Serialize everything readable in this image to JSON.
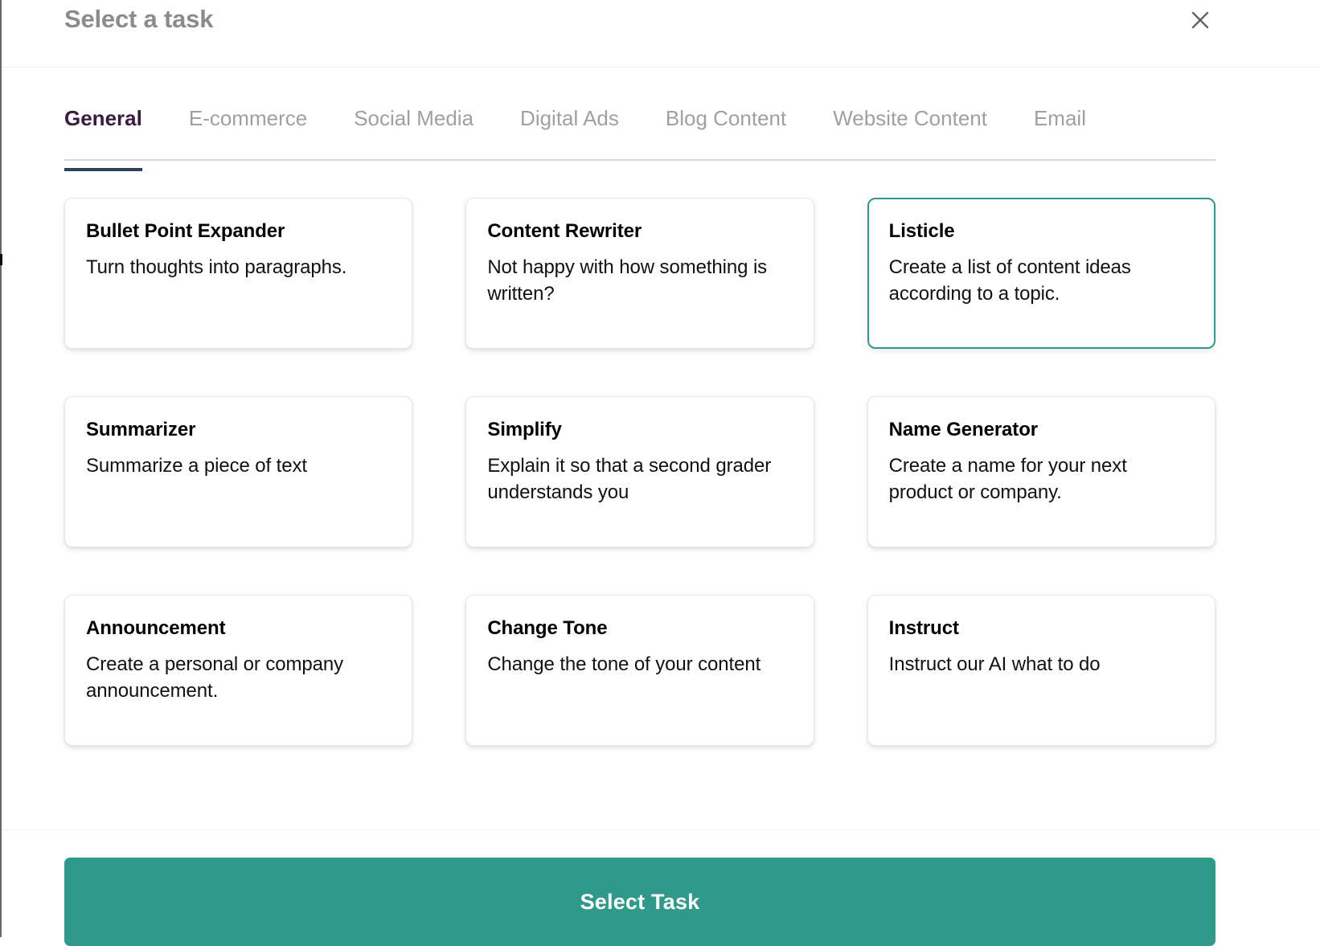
{
  "header": {
    "title": "Select a task",
    "close_icon": "close-icon"
  },
  "tabs": [
    {
      "label": "General",
      "active": true
    },
    {
      "label": "E-commerce",
      "active": false
    },
    {
      "label": "Social Media",
      "active": false
    },
    {
      "label": "Digital Ads",
      "active": false
    },
    {
      "label": "Blog Content",
      "active": false
    },
    {
      "label": "Website Content",
      "active": false
    },
    {
      "label": "Email",
      "active": false
    }
  ],
  "cards": [
    {
      "title": "Bullet Point Expander",
      "description": "Turn thoughts into paragraphs.",
      "selected": false
    },
    {
      "title": "Content Rewriter",
      "description": "Not happy with how something is written?",
      "selected": false
    },
    {
      "title": "Listicle",
      "description": "Create a list of content ideas according to a topic.",
      "selected": true
    },
    {
      "title": "Summarizer",
      "description": "Summarize a piece of text",
      "selected": false
    },
    {
      "title": "Simplify",
      "description": "Explain it so that a second grader understands you",
      "selected": false
    },
    {
      "title": "Name Generator",
      "description": "Create a name for your next product or company.",
      "selected": false
    },
    {
      "title": "Announcement",
      "description": "Create a personal or company announcement.",
      "selected": false
    },
    {
      "title": "Change Tone",
      "description": "Change the tone of your content",
      "selected": false
    },
    {
      "title": "Instruct",
      "description": "Instruct our AI what to do",
      "selected": false
    }
  ],
  "footer": {
    "submit_label": "Select Task"
  },
  "colors": {
    "accent_teal": "#2f9a8a",
    "selected_border": "#2b9b8b",
    "tab_active_text": "#3b1a42",
    "tab_underline": "#2e4256",
    "tab_inactive_text": "#a0a0a4",
    "title_gray": "#8b8b8b"
  }
}
